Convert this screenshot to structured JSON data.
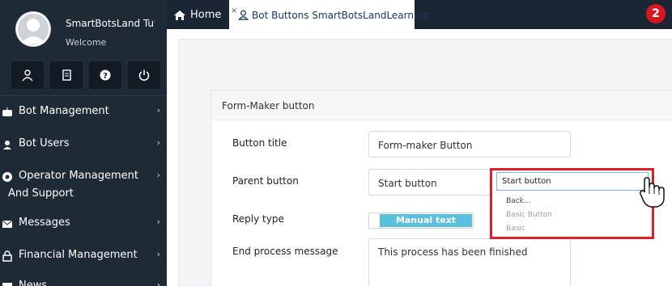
{
  "sidebar": {
    "user_name": "SmartBotsLand Tutorials",
    "user_sub": "Welcome",
    "quick_icons": [
      "user-icon",
      "document-icon",
      "help-icon",
      "power-icon"
    ],
    "items": [
      {
        "label": "Bot Management",
        "icon": "robot-icon"
      },
      {
        "label": "Bot Users",
        "icon": "users-icon"
      },
      {
        "label": "Operator Management And Support",
        "icon": "support-icon"
      },
      {
        "label": "Messages",
        "icon": "envelope-icon"
      },
      {
        "label": "Financial Management",
        "icon": "lock-icon"
      },
      {
        "label": "News",
        "icon": "news-icon"
      }
    ]
  },
  "tabs": {
    "home_label": "Home",
    "active_label": "Bot Buttons SmartBotsLandLearning",
    "close": "×"
  },
  "badge": "2",
  "form": {
    "card_title": "Form-Maker button",
    "button_title_label": "Button title",
    "button_title_value": "Form-maker Button",
    "parent_button_label": "Parent button",
    "parent_button_value": "Start button",
    "reply_type_label": "Reply type",
    "reply_type_value": "Manual text",
    "end_message_label": "End process message",
    "end_message_value": "This process has been finished"
  },
  "dropdown": {
    "selected": "Start button",
    "options": [
      "Back...",
      "Basic Button",
      "Basic"
    ]
  },
  "colors": {
    "sidebar_bg": "#1f2a37",
    "tabbar_bg": "#1a2633",
    "accent": "#5bc0de",
    "highlight": "#e02028",
    "badge": "#d7171f"
  }
}
